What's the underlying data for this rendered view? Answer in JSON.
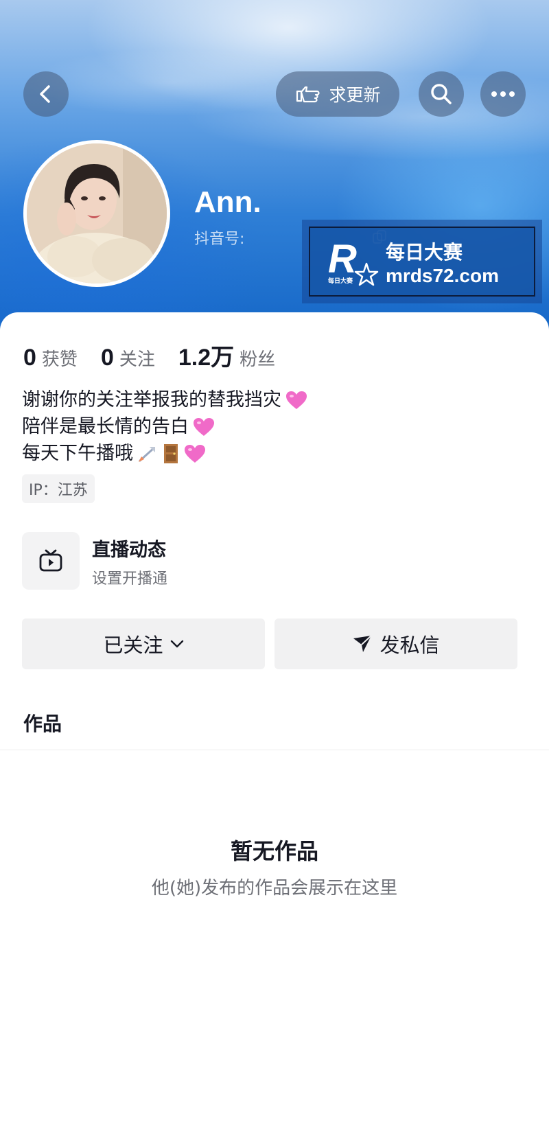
{
  "header": {
    "request_update_label": "求更新",
    "username": "Ann.",
    "douyin_id_label": "抖音号:"
  },
  "watermark": {
    "logo_letter": "R",
    "logo_small": "每日大赛",
    "name": "每日大赛",
    "url": "mrds72.com"
  },
  "stats": [
    {
      "value": "0",
      "label": "获赞"
    },
    {
      "value": "0",
      "label": "关注"
    },
    {
      "value": "1.2万",
      "label": "粉丝"
    }
  ],
  "bio": [
    "谢谢你的关注举报我的替我挡灾",
    "陪伴是最长情的告白",
    "每天下午播哦"
  ],
  "ip": "IP：江苏",
  "live": {
    "title": "直播动态",
    "subtitle": "设置开播通"
  },
  "actions": {
    "follow_label": "已关注",
    "message_label": "发私信"
  },
  "works": {
    "section_title": "作品",
    "empty_title": "暂无作品",
    "empty_subtitle": "他(她)发布的作品会展示在这里"
  },
  "colors": {
    "header_blue": "#1668c8",
    "heart_pink": "#f06ac8"
  },
  "icons": [
    "back-arrow-icon",
    "hand-point-icon",
    "search-icon",
    "more-icon",
    "copy-icon",
    "tv-icon",
    "chevron-down-icon",
    "send-icon",
    "heart-icon",
    "rocket-icon",
    "door-icon"
  ]
}
